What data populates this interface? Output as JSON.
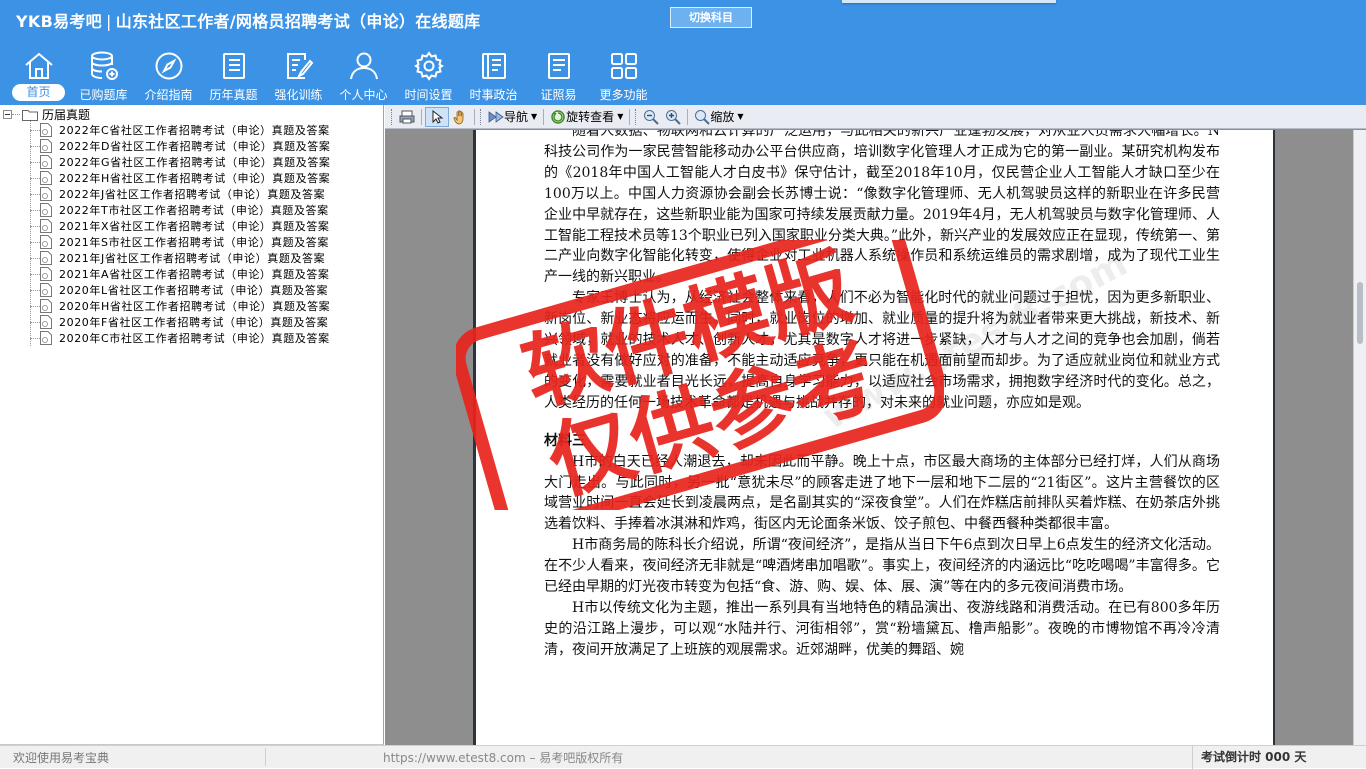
{
  "header": {
    "brand": "YKB易考吧",
    "title": "山东社区工作者/网格员招聘考试（申论）在线题库",
    "switch_label": "切换科目",
    "bg_color": "#3c92e4"
  },
  "nav": [
    {
      "label": "首页",
      "icon": "home-icon",
      "active": true
    },
    {
      "label": "已购题库",
      "icon": "database-icon"
    },
    {
      "label": "介绍指南",
      "icon": "compass-icon"
    },
    {
      "label": "历年真题",
      "icon": "list-document-icon"
    },
    {
      "label": "强化训练",
      "icon": "edit-document-icon"
    },
    {
      "label": "个人中心",
      "icon": "user-icon"
    },
    {
      "label": "时间设置",
      "icon": "gear-icon"
    },
    {
      "label": "时事政治",
      "icon": "book-icon"
    },
    {
      "label": "证照易",
      "icon": "notes-icon"
    },
    {
      "label": "更多功能",
      "icon": "grid-icon"
    }
  ],
  "tree": {
    "root": "历届真题",
    "items": [
      "2022年C省社区工作者招聘考试（申论）真题及答案",
      "2022年D省社区工作者招聘考试（申论）真题及答案",
      "2022年G省社区工作者招聘考试（申论）真题及答案",
      "2022年H省社区工作者招聘考试（申论）真题及答案",
      "2022年J省社区工作者招聘考试（申论）真题及答案",
      "2022年T市社区工作者招聘考试（申论）真题及答案",
      "2021年X省社区工作者招聘考试（申论）真题及答案",
      "2021年S市社区工作者招聘考试（申论）真题及答案",
      "2021年J省社区工作者招聘考试（申论）真题及答案",
      "2021年A省社区工作者招聘考试（申论）真题及答案",
      "2020年L省社区工作者招聘考试（申论）真题及答案",
      "2020年H省社区工作者招聘考试（申论）真题及答案",
      "2020年F省社区工作者招聘考试（申论）真题及答案",
      "2020年C市社区工作者招聘考试（申论）真题及答案"
    ]
  },
  "toolbar": {
    "nav_label": "导航",
    "rotate_label": "旋转查看",
    "zoom_label": "缩放"
  },
  "document": {
    "p1_cont": "随着人数据、物联网和云计算的广泛运用，与此相关的新兴产业蓬勃发展，对从业人员需求大幅增长。N科技公司作为一家民营智能移动办公平台供应商，培训数字化管理人才正成为它的第一副业。某研究机构发布的《2018年中国人工智能人才白皮书》保守估计，截至2018年10月，仅民营企业人工智能人才缺口至少在100万以上。中国人力资源协会副会长苏博士说：“像数字化管理师、无人机驾驶员这样的新职业在许多民营企业中早就存在，这些新职业能为国家可持续发展贡献力量。2019年4月，无人机驾驶员与数字化管理师、人工智能工程技术员等13个职业已列入国家职业分类大典。”此外，新兴产业的发展效应正在显现，传统第一、第二产业向数字化智能化转变，使得企业对工业机器人系统操作员和系统运维员的需求剧增，成为了现代工业生产一线的新兴职业。",
    "p2": "专家王博士认为，从经济社会整体来看，人们不必为智能化时代的就业问题过于担忧，因为更多新职业、新岗位、新业态将应运而生。同时，就业岗位的增加、就业质量的提升将为就业者带来更大挑战，新技术、新兴领域，就业的技术人才、创新人才，尤其是数字人才将进一步紧缺，人才与人才之间的竞争也会加剧，倘若就业者没有做好应对的准备，不能主动适应竞争，更只能在机遇面前望而却步。为了适应就业岗位和就业方式的变化，需要就业者目光长远，提高自身学习能力，以适应社会市场需求，拥抱数字经济时代的变化。总之，人类经历的任何一场技术革命都是机遇与挑战并存的，对未来的就业问题，亦应如是观。",
    "heading": "材料三",
    "p3": "H市的白天已经人潮退去，却未因此而平静。晚上十点，市区最大商场的主体部分已经打烊，人们从商场大门走出。与此同时，另一批“意犹未尽”的顾客走进了地下一层和地下二层的“21街区”。这片主营餐饮的区域营业时间一直会延长到凌晨两点，是名副其实的“深夜食堂”。人们在炸糕店前排队买着炸糕、在奶茶店外挑选着饮料、手捧着冰淇淋和炸鸡，街区内无论面条米饭、饺子煎包、中餐西餐种类都很丰富。",
    "p4": "H市商务局的陈科长介绍说，所谓“夜间经济”，是指从当日下午6点到次日早上6点发生的经济文化活动。在不少人看来，夜间经济无非就是“啤酒烤串加唱歌”。事实上，夜间经济的内涵远比“吃吃喝喝”丰富得多。它已经由早期的灯光夜市转变为包括“食、游、购、娱、体、展、演”等在内的多元夜间消费市场。",
    "p5": "H市以传统文化为主题，推出一系列具有当地特色的精品演出、夜游线路和消费活动。在已有800多年历史的沿江路上漫步，可以观“水陆并行、河街相邻”，赏“粉墙黛瓦、橹声船影”。夜晚的市博物馆不再冷冷清清，夜间开放满足了上班族的观展需求。近郊湖畔，优美的舞蹈、婉"
  },
  "watermark": {
    "line1": "软件模版",
    "line2": "仅供参考",
    "url_text": "www.etest8.com",
    "color": "#e8231c"
  },
  "status": {
    "left": "欢迎使用易考宝典",
    "mid": "https://www.etest8.com – 易考吧版权所有",
    "right": "考试倒计时 000 天"
  }
}
